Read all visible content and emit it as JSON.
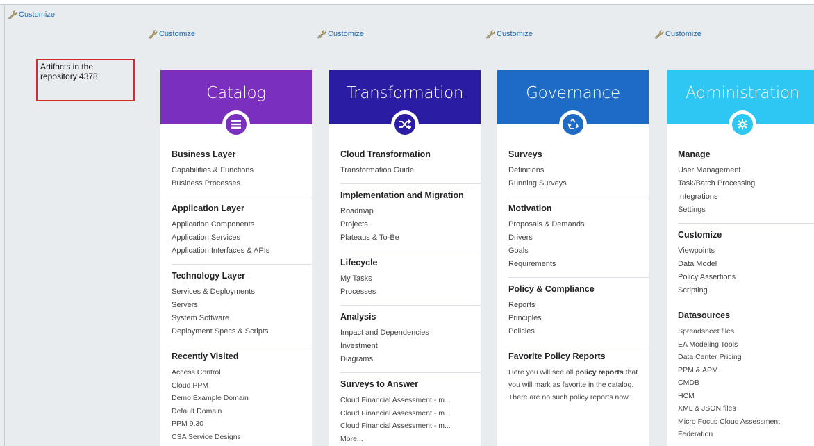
{
  "customize_label": "Customize",
  "artifacts": {
    "line1": "Artifacts in the",
    "line2": "repository:4378"
  },
  "colors": {
    "catalog": "#7b2fbe",
    "transformation": "#2a1ca3",
    "governance": "#1e6bc6",
    "administration": "#2ec6f3",
    "link": "#1f6db5",
    "highlight_box": "#d42b2b"
  },
  "cards": [
    {
      "title": "Catalog",
      "icon": "menu-lines-icon",
      "sections": [
        {
          "title": "Business Layer",
          "items": [
            "Capabilities & Functions",
            "Business Processes"
          ]
        },
        {
          "title": "Application Layer",
          "items": [
            "Application Components",
            "Application Services",
            "Application Interfaces & APIs"
          ]
        },
        {
          "title": "Technology Layer",
          "items": [
            "Services & Deployments",
            "Servers",
            "System Software",
            "Deployment Specs & Scripts"
          ]
        },
        {
          "title": "Recently Visited",
          "items": [
            "Access Control",
            "Cloud PPM",
            "Demo Example Domain",
            "Default Domain",
            "PPM 9.30",
            "CSA Service Designs"
          ]
        }
      ]
    },
    {
      "title": "Transformation",
      "icon": "shuffle-icon",
      "sections": [
        {
          "title": "Cloud Transformation",
          "items": [
            "Transformation Guide"
          ]
        },
        {
          "title": "Implementation and Migration",
          "items": [
            "Roadmap",
            "Projects",
            "Plateaus & To-Be"
          ]
        },
        {
          "title": "Lifecycle",
          "items": [
            "My Tasks",
            "Processes"
          ]
        },
        {
          "title": "Analysis",
          "items": [
            "Impact and Dependencies",
            "Investment",
            "Diagrams"
          ]
        },
        {
          "title": "Surveys to Answer",
          "items": [
            "Cloud Financial Assessment - m...",
            "Cloud Financial Assessment - m...",
            "Cloud Financial Assessment - m...",
            "More..."
          ]
        }
      ]
    },
    {
      "title": "Governance",
      "icon": "recycle-icon",
      "sections": [
        {
          "title": "Surveys",
          "items": [
            "Definitions",
            "Running Surveys"
          ]
        },
        {
          "title": "Motivation",
          "items": [
            "Proposals & Demands",
            "Drivers",
            "Goals",
            "Requirements"
          ]
        },
        {
          "title": "Policy & Compliance",
          "items": [
            "Reports",
            "Principles",
            "Policies"
          ]
        },
        {
          "title": "Favorite Policy Reports",
          "paragraph": {
            "before": "Here you will see all ",
            "bold": "policy reports",
            "after": " that you will mark as favorite in the catalog. There are no such policy reports now."
          }
        }
      ]
    },
    {
      "title": "Administration",
      "icon": "gear-icon",
      "sections": [
        {
          "title": "Manage",
          "items": [
            "User Management",
            "Task/Batch Processing",
            "Integrations",
            "Settings"
          ]
        },
        {
          "title": "Customize",
          "items": [
            "Viewpoints",
            "Data Model",
            "Policy Assertions",
            "Scripting"
          ]
        },
        {
          "title": "Datasources",
          "items": [
            "Spreadsheet files",
            "EA Modeling Tools",
            "Data Center Pricing",
            "PPM & APM",
            "CMDB",
            "HCM",
            "XML & JSON files",
            "Micro Focus Cloud Assessment",
            "Federation"
          ]
        }
      ]
    }
  ]
}
